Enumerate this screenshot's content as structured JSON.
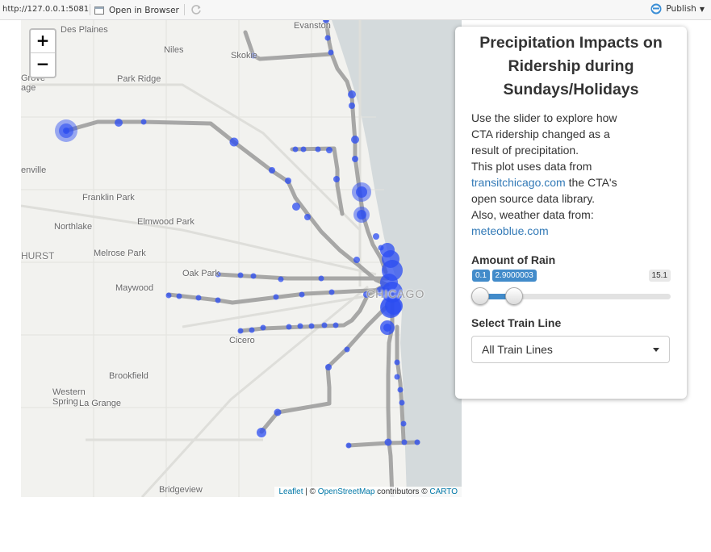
{
  "toolbar": {
    "url": "http://127.0.0.1:5081",
    "open_in_browser": "Open in Browser",
    "publish": "Publish"
  },
  "map": {
    "zoom_in": "+",
    "zoom_out": "−",
    "places": [
      "Des Plaines",
      "Evanston",
      "Niles",
      "Skokie",
      "Grove",
      "age",
      "Park Ridge",
      "enville",
      "Franklin Park",
      "Northlake",
      "Elmwood Park",
      "HURST",
      "Melrose Park",
      "Oak Park",
      "Maywood",
      "CHICAGO",
      "Cicero",
      "Brookfield",
      "Western",
      "Spring",
      "La Grange",
      "Bridgeview"
    ],
    "attribution": {
      "leaflet": "Leaflet",
      "sep1": " | © ",
      "osm": "OpenStreetMap",
      "mid": " contributors © ",
      "carto": "CARTO"
    }
  },
  "panel": {
    "title": "Precipitation Impacts on Ridership during Sundays/Holidays",
    "desc_line1": "Use the slider to explore how CTA ridership changed as a result of precipitation.",
    "desc_line2": "This plot uses data from",
    "desc_link1": "transitchicago.com",
    "desc_line3": " the CTA's open source data library.",
    "desc_line4": "Also, weather data from:",
    "desc_link2": "meteoblue.com",
    "rain_label": "Amount of Rain",
    "rain_min": "0.1",
    "rain_max": "15.1",
    "rain_value": "2.9000003",
    "rain_fraction": 0.187,
    "line_label": "Select Train Line",
    "line_selected": "All Train Lines"
  },
  "colors": {
    "station": "#2b4cf2",
    "track": "#9a9a9a",
    "lake": "#d4dadc",
    "accent": "#428bca"
  }
}
